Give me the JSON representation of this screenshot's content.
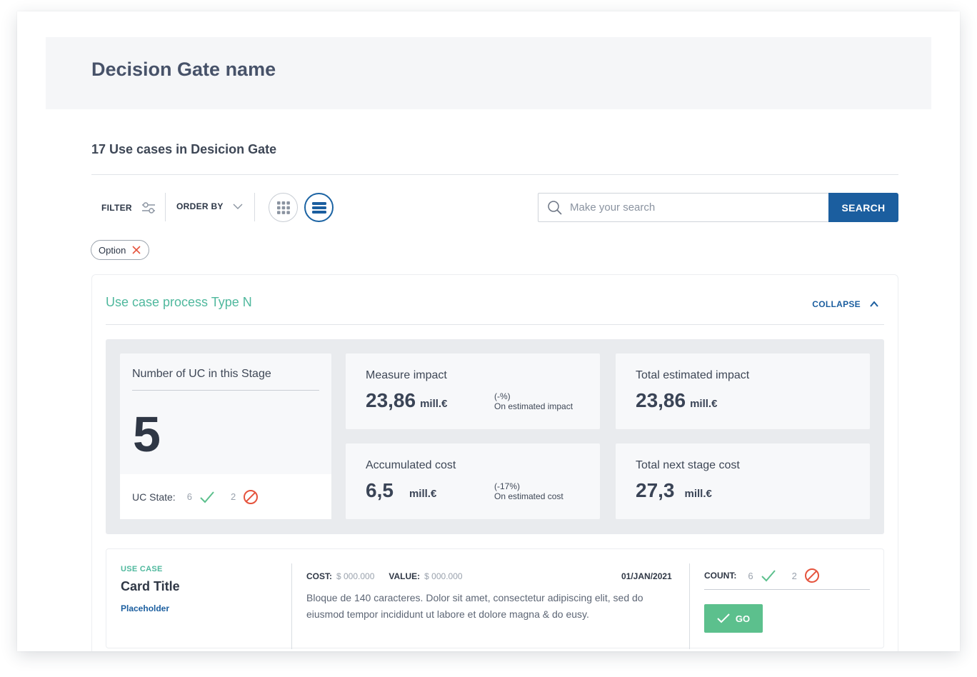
{
  "header": {
    "title": "Decision Gate name"
  },
  "summary": {
    "count_title": "17 Use cases in Desicion Gate"
  },
  "toolbar": {
    "filter_label": "FILTER",
    "order_label": "ORDER BY",
    "search_placeholder": "Make your search",
    "search_button": "SEARCH",
    "active_view": "list"
  },
  "chips": [
    {
      "label": "Option"
    }
  ],
  "panel": {
    "title": "Use case process Type N",
    "collapse_label": "COLLAPSE",
    "stage": {
      "title": "Number of UC in this Stage",
      "value": "5",
      "state_label": "UC State:",
      "approved_count": "6",
      "rejected_count": "2"
    },
    "metrics": [
      {
        "title": "Measure impact",
        "value": "23,86",
        "unit": "mill.€",
        "delta": "(-%)",
        "delta_note": "On estimated impact"
      },
      {
        "title": "Total estimated impact",
        "value": "23,86",
        "unit": "mill.€"
      },
      {
        "title": "Accumulated cost",
        "value": "6,5",
        "unit": "mill.€",
        "delta": "(-17%)",
        "delta_note": "On estimated cost"
      },
      {
        "title": "Total next stage cost",
        "value": "27,3",
        "unit": "mill.€"
      }
    ]
  },
  "use_case": {
    "kicker": "USE CASE",
    "title": "Card Title",
    "link": "Placeholder",
    "cost_label": "COST:",
    "cost_value": "$ 000.000",
    "value_label": "VALUE:",
    "value_value": "$ 000.000",
    "date": "01/JAN/2021",
    "description": "Bloque de 140 caracteres. Dolor sit amet, consectetur adipiscing elit, sed do eiusmod tempor incididunt ut labore et dolore magna & do eusy.",
    "count_label": "COUNT:",
    "approved_count": "6",
    "rejected_count": "2",
    "go_label": "GO"
  },
  "colors": {
    "accent_blue": "#1b5e9f",
    "accent_green": "#4fb89d",
    "approve_green": "#5cc08d",
    "reject_red": "#e5533d"
  }
}
